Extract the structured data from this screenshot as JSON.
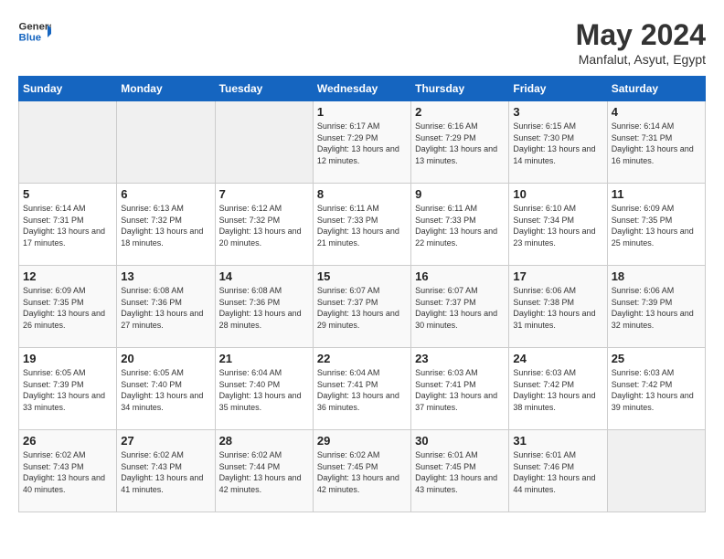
{
  "header": {
    "logo": {
      "text_general": "General",
      "text_blue": "Blue",
      "icon": "▶"
    },
    "title": "May 2024",
    "location": "Manfalut, Asyut, Egypt"
  },
  "weekdays": [
    "Sunday",
    "Monday",
    "Tuesday",
    "Wednesday",
    "Thursday",
    "Friday",
    "Saturday"
  ],
  "weeks": [
    [
      {
        "day": "",
        "sunrise": "",
        "sunset": "",
        "daylight": "",
        "empty": true
      },
      {
        "day": "",
        "sunrise": "",
        "sunset": "",
        "daylight": "",
        "empty": true
      },
      {
        "day": "",
        "sunrise": "",
        "sunset": "",
        "daylight": "",
        "empty": true
      },
      {
        "day": "1",
        "sunrise": "Sunrise: 6:17 AM",
        "sunset": "Sunset: 7:29 PM",
        "daylight": "Daylight: 13 hours and 12 minutes.",
        "empty": false
      },
      {
        "day": "2",
        "sunrise": "Sunrise: 6:16 AM",
        "sunset": "Sunset: 7:29 PM",
        "daylight": "Daylight: 13 hours and 13 minutes.",
        "empty": false
      },
      {
        "day": "3",
        "sunrise": "Sunrise: 6:15 AM",
        "sunset": "Sunset: 7:30 PM",
        "daylight": "Daylight: 13 hours and 14 minutes.",
        "empty": false
      },
      {
        "day": "4",
        "sunrise": "Sunrise: 6:14 AM",
        "sunset": "Sunset: 7:31 PM",
        "daylight": "Daylight: 13 hours and 16 minutes.",
        "empty": false
      }
    ],
    [
      {
        "day": "5",
        "sunrise": "Sunrise: 6:14 AM",
        "sunset": "Sunset: 7:31 PM",
        "daylight": "Daylight: 13 hours and 17 minutes.",
        "empty": false
      },
      {
        "day": "6",
        "sunrise": "Sunrise: 6:13 AM",
        "sunset": "Sunset: 7:32 PM",
        "daylight": "Daylight: 13 hours and 18 minutes.",
        "empty": false
      },
      {
        "day": "7",
        "sunrise": "Sunrise: 6:12 AM",
        "sunset": "Sunset: 7:32 PM",
        "daylight": "Daylight: 13 hours and 20 minutes.",
        "empty": false
      },
      {
        "day": "8",
        "sunrise": "Sunrise: 6:11 AM",
        "sunset": "Sunset: 7:33 PM",
        "daylight": "Daylight: 13 hours and 21 minutes.",
        "empty": false
      },
      {
        "day": "9",
        "sunrise": "Sunrise: 6:11 AM",
        "sunset": "Sunset: 7:33 PM",
        "daylight": "Daylight: 13 hours and 22 minutes.",
        "empty": false
      },
      {
        "day": "10",
        "sunrise": "Sunrise: 6:10 AM",
        "sunset": "Sunset: 7:34 PM",
        "daylight": "Daylight: 13 hours and 23 minutes.",
        "empty": false
      },
      {
        "day": "11",
        "sunrise": "Sunrise: 6:09 AM",
        "sunset": "Sunset: 7:35 PM",
        "daylight": "Daylight: 13 hours and 25 minutes.",
        "empty": false
      }
    ],
    [
      {
        "day": "12",
        "sunrise": "Sunrise: 6:09 AM",
        "sunset": "Sunset: 7:35 PM",
        "daylight": "Daylight: 13 hours and 26 minutes.",
        "empty": false
      },
      {
        "day": "13",
        "sunrise": "Sunrise: 6:08 AM",
        "sunset": "Sunset: 7:36 PM",
        "daylight": "Daylight: 13 hours and 27 minutes.",
        "empty": false
      },
      {
        "day": "14",
        "sunrise": "Sunrise: 6:08 AM",
        "sunset": "Sunset: 7:36 PM",
        "daylight": "Daylight: 13 hours and 28 minutes.",
        "empty": false
      },
      {
        "day": "15",
        "sunrise": "Sunrise: 6:07 AM",
        "sunset": "Sunset: 7:37 PM",
        "daylight": "Daylight: 13 hours and 29 minutes.",
        "empty": false
      },
      {
        "day": "16",
        "sunrise": "Sunrise: 6:07 AM",
        "sunset": "Sunset: 7:37 PM",
        "daylight": "Daylight: 13 hours and 30 minutes.",
        "empty": false
      },
      {
        "day": "17",
        "sunrise": "Sunrise: 6:06 AM",
        "sunset": "Sunset: 7:38 PM",
        "daylight": "Daylight: 13 hours and 31 minutes.",
        "empty": false
      },
      {
        "day": "18",
        "sunrise": "Sunrise: 6:06 AM",
        "sunset": "Sunset: 7:39 PM",
        "daylight": "Daylight: 13 hours and 32 minutes.",
        "empty": false
      }
    ],
    [
      {
        "day": "19",
        "sunrise": "Sunrise: 6:05 AM",
        "sunset": "Sunset: 7:39 PM",
        "daylight": "Daylight: 13 hours and 33 minutes.",
        "empty": false
      },
      {
        "day": "20",
        "sunrise": "Sunrise: 6:05 AM",
        "sunset": "Sunset: 7:40 PM",
        "daylight": "Daylight: 13 hours and 34 minutes.",
        "empty": false
      },
      {
        "day": "21",
        "sunrise": "Sunrise: 6:04 AM",
        "sunset": "Sunset: 7:40 PM",
        "daylight": "Daylight: 13 hours and 35 minutes.",
        "empty": false
      },
      {
        "day": "22",
        "sunrise": "Sunrise: 6:04 AM",
        "sunset": "Sunset: 7:41 PM",
        "daylight": "Daylight: 13 hours and 36 minutes.",
        "empty": false
      },
      {
        "day": "23",
        "sunrise": "Sunrise: 6:03 AM",
        "sunset": "Sunset: 7:41 PM",
        "daylight": "Daylight: 13 hours and 37 minutes.",
        "empty": false
      },
      {
        "day": "24",
        "sunrise": "Sunrise: 6:03 AM",
        "sunset": "Sunset: 7:42 PM",
        "daylight": "Daylight: 13 hours and 38 minutes.",
        "empty": false
      },
      {
        "day": "25",
        "sunrise": "Sunrise: 6:03 AM",
        "sunset": "Sunset: 7:42 PM",
        "daylight": "Daylight: 13 hours and 39 minutes.",
        "empty": false
      }
    ],
    [
      {
        "day": "26",
        "sunrise": "Sunrise: 6:02 AM",
        "sunset": "Sunset: 7:43 PM",
        "daylight": "Daylight: 13 hours and 40 minutes.",
        "empty": false
      },
      {
        "day": "27",
        "sunrise": "Sunrise: 6:02 AM",
        "sunset": "Sunset: 7:43 PM",
        "daylight": "Daylight: 13 hours and 41 minutes.",
        "empty": false
      },
      {
        "day": "28",
        "sunrise": "Sunrise: 6:02 AM",
        "sunset": "Sunset: 7:44 PM",
        "daylight": "Daylight: 13 hours and 42 minutes.",
        "empty": false
      },
      {
        "day": "29",
        "sunrise": "Sunrise: 6:02 AM",
        "sunset": "Sunset: 7:45 PM",
        "daylight": "Daylight: 13 hours and 42 minutes.",
        "empty": false
      },
      {
        "day": "30",
        "sunrise": "Sunrise: 6:01 AM",
        "sunset": "Sunset: 7:45 PM",
        "daylight": "Daylight: 13 hours and 43 minutes.",
        "empty": false
      },
      {
        "day": "31",
        "sunrise": "Sunrise: 6:01 AM",
        "sunset": "Sunset: 7:46 PM",
        "daylight": "Daylight: 13 hours and 44 minutes.",
        "empty": false
      },
      {
        "day": "",
        "sunrise": "",
        "sunset": "",
        "daylight": "",
        "empty": true
      }
    ]
  ]
}
